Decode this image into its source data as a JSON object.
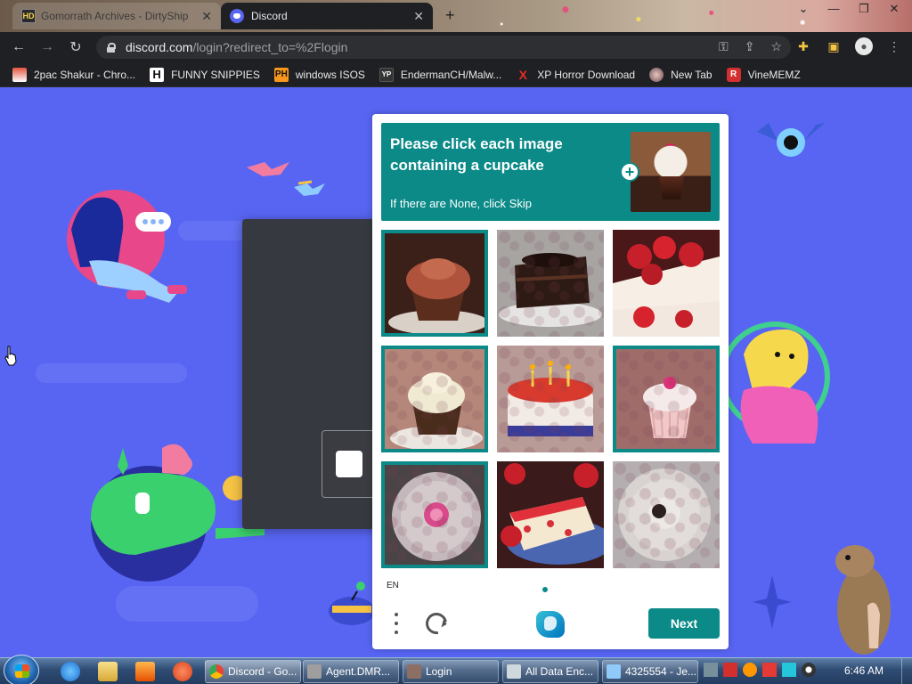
{
  "browser": {
    "tabs": [
      {
        "label": "Gomorrath Archives - DirtyShip",
        "favicon": "hd-icon"
      },
      {
        "label": "Discord",
        "favicon": "discord-icon"
      }
    ],
    "address": {
      "host": "discord.com",
      "path": "/login?redirect_to=%2Flogin"
    },
    "bookmarks": [
      {
        "label": "2pac Shakur - Chro...",
        "icon": "2pac-icon"
      },
      {
        "label": "FUNNY SNIPPIES",
        "icon": "H"
      },
      {
        "label": "windows ISOS",
        "icon": "PH"
      },
      {
        "label": "EndermanCH/Malw...",
        "icon": "YP"
      },
      {
        "label": "XP Horror Download",
        "icon": "X"
      },
      {
        "label": "New Tab",
        "icon": "newtab-icon"
      },
      {
        "label": "VineMEMZ",
        "icon": "R"
      }
    ]
  },
  "captcha": {
    "prompt_title": "Please click each image containing a cupcake",
    "prompt_sub": "If there are None, click Skip",
    "grid": [
      {
        "subject": "chocolate cupcake",
        "selected": true
      },
      {
        "subject": "chocolate cake slice",
        "selected": false
      },
      {
        "subject": "strawberry cake",
        "selected": false
      },
      {
        "subject": "vanilla cupcake",
        "selected": true
      },
      {
        "subject": "birthday cake with candles",
        "selected": false
      },
      {
        "subject": "pink frosted cupcake",
        "selected": true
      },
      {
        "subject": "cupcake on plate top view",
        "selected": true
      },
      {
        "subject": "strawberry cake slice",
        "selected": false
      },
      {
        "subject": "cupcake on plate top view",
        "selected": false
      }
    ],
    "lang": "EN",
    "next_label": "Next",
    "colors": {
      "accent": "#0b8a88"
    }
  },
  "taskbar": {
    "tasks": [
      {
        "label": "Discord - Go..."
      },
      {
        "label": "Agent.DMR..."
      },
      {
        "label": "Login"
      },
      {
        "label": "All Data Enc..."
      },
      {
        "label": "4325554 - Je..."
      }
    ],
    "clock": "6:46 AM"
  }
}
